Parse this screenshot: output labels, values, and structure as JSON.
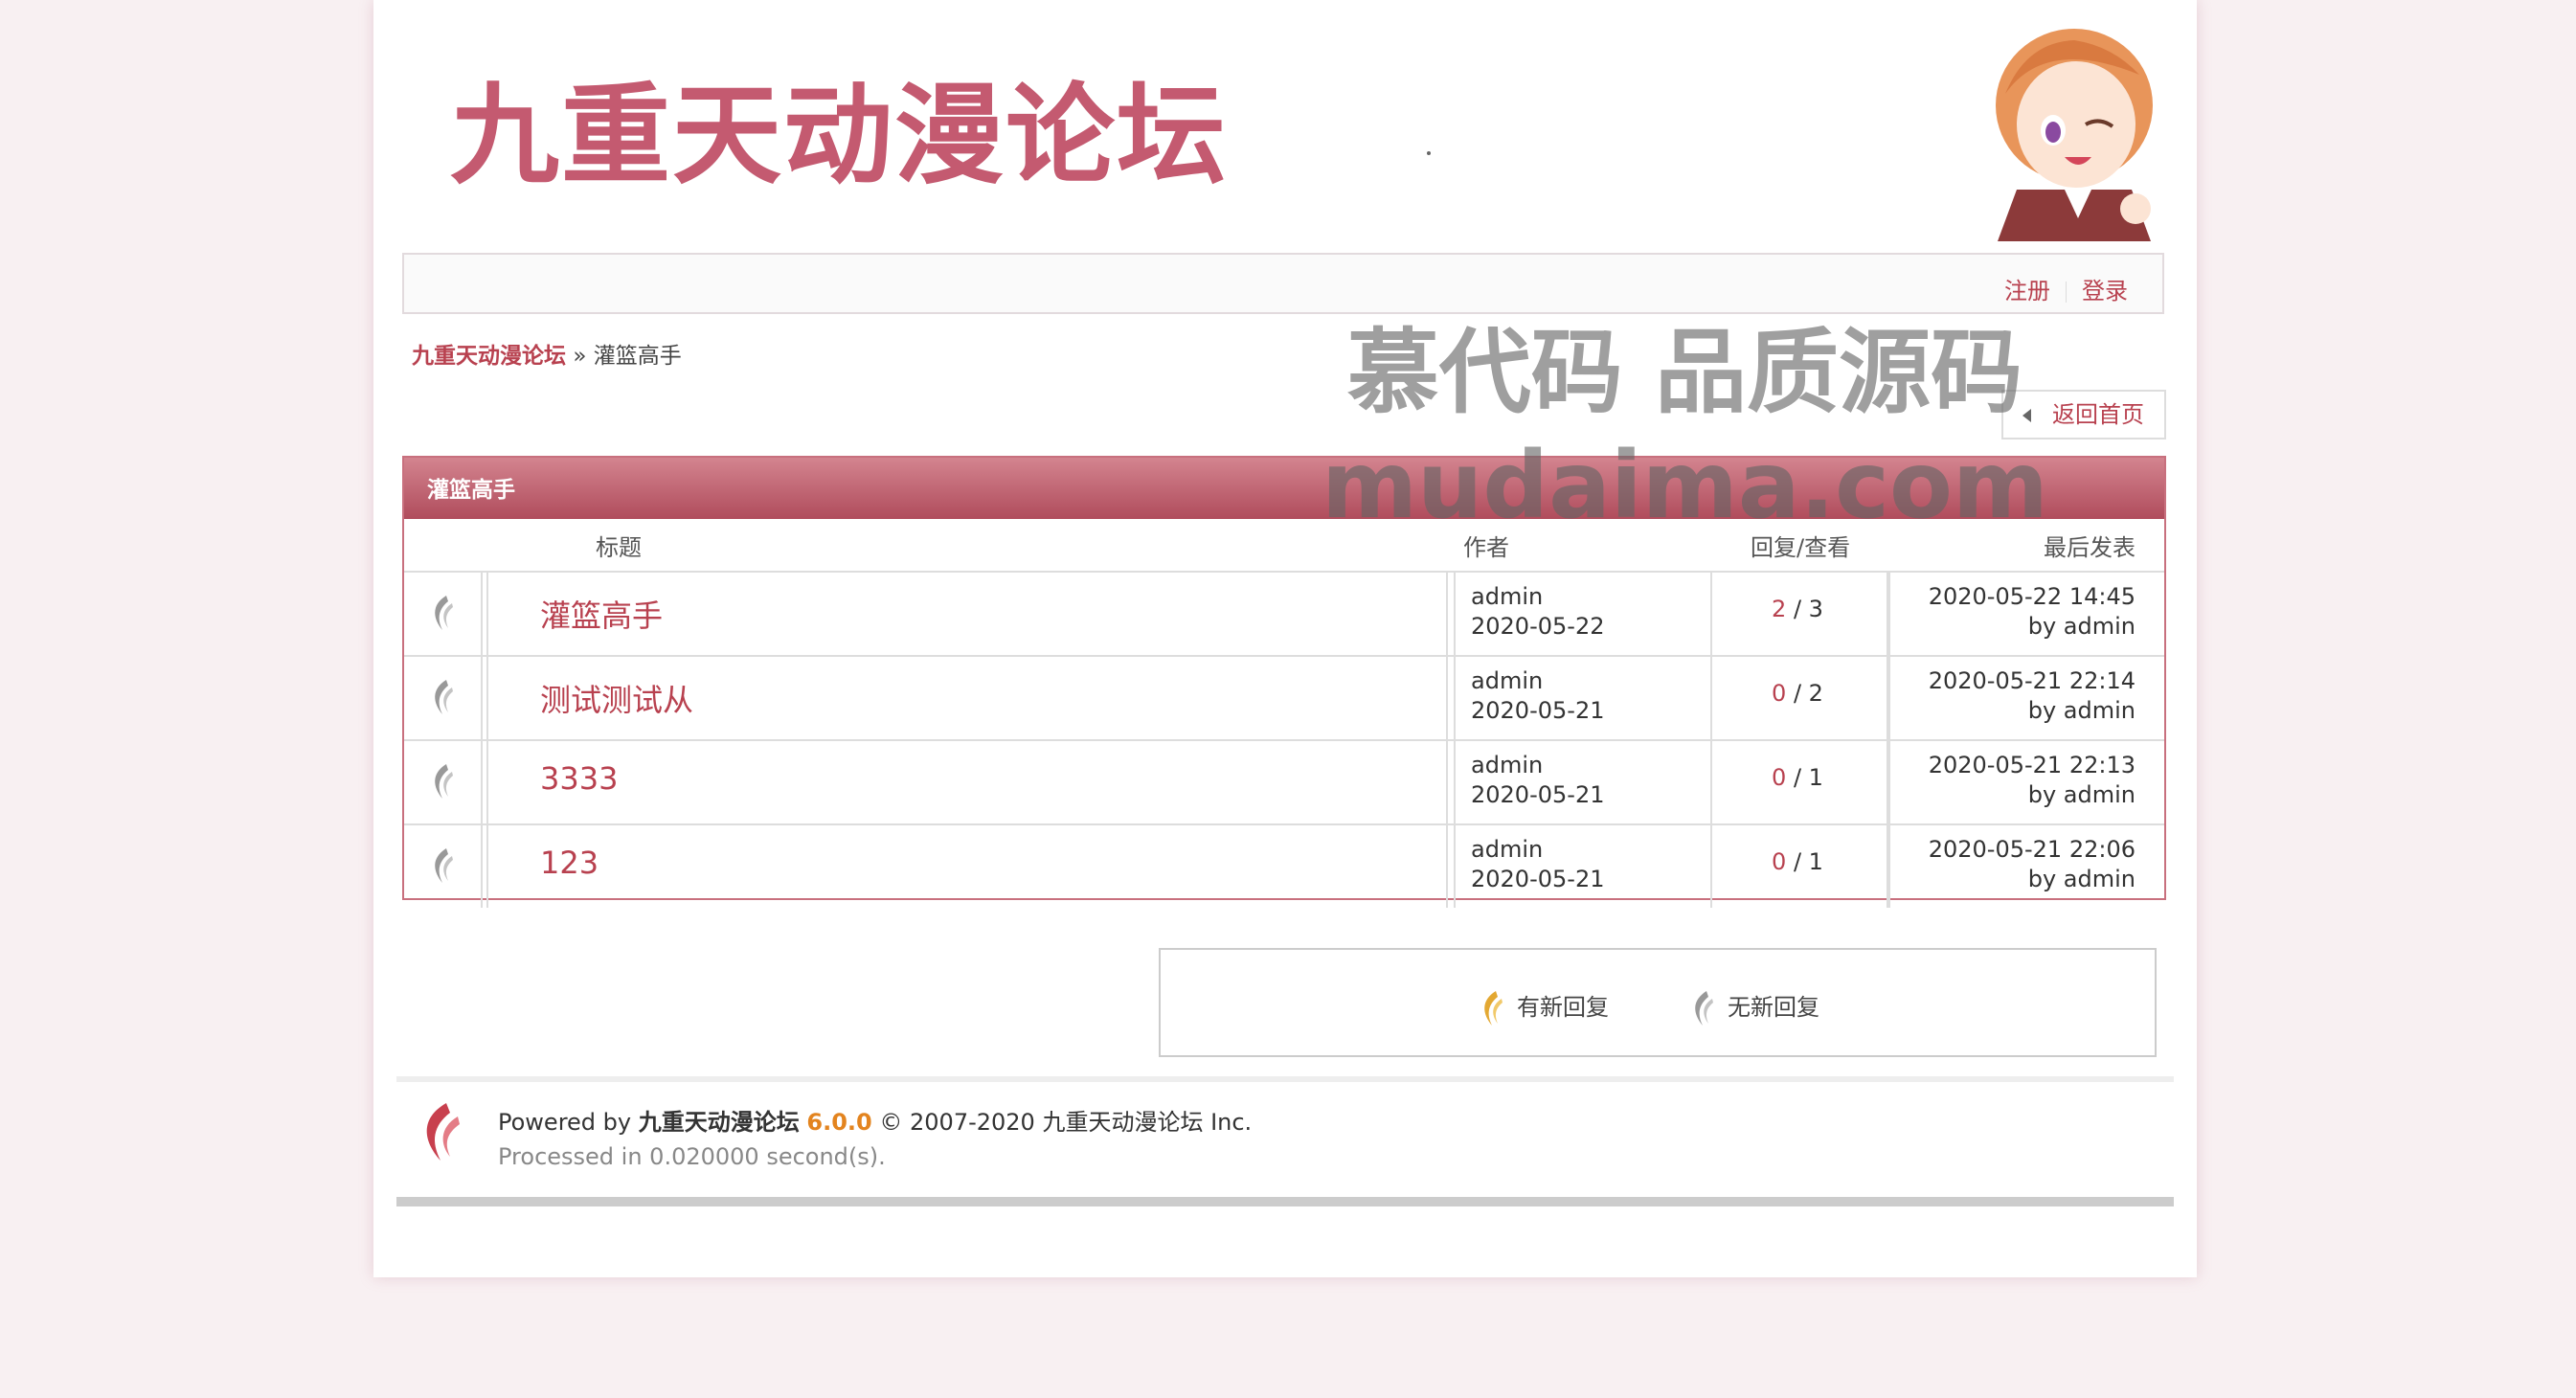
{
  "header": {
    "logo_text": "九重天动漫论坛"
  },
  "userbar": {
    "register": "注册",
    "login": "登录"
  },
  "breadcrumb": {
    "home": "九重天动漫论坛",
    "separator": "»",
    "current": "灌篮高手"
  },
  "back_button": "返回首页",
  "board": {
    "title": "灌篮高手",
    "columns": {
      "title": "标题",
      "author": "作者",
      "replies_views": "回复/查看",
      "last_post": "最后发表"
    },
    "threads": [
      {
        "title": "灌篮高手",
        "author": "admin",
        "date": "2020-05-22",
        "replies": "2",
        "views": "3",
        "last_time": "2020-05-22 14:45",
        "last_by": "by admin"
      },
      {
        "title": "测试测试从",
        "author": "admin",
        "date": "2020-05-21",
        "replies": "0",
        "views": "2",
        "last_time": "2020-05-21 22:14",
        "last_by": "by admin"
      },
      {
        "title": "3333",
        "author": "admin",
        "date": "2020-05-21",
        "replies": "0",
        "views": "1",
        "last_time": "2020-05-21 22:13",
        "last_by": "by admin"
      },
      {
        "title": "123",
        "author": "admin",
        "date": "2020-05-21",
        "replies": "0",
        "views": "1",
        "last_time": "2020-05-21 22:06",
        "last_by": "by admin"
      }
    ]
  },
  "legend": {
    "new_reply": "有新回复",
    "no_new_reply": "无新回复"
  },
  "footer": {
    "powered_by": "Powered by",
    "name": "九重天动漫论坛",
    "version": "6.0.0",
    "copyright": "© 2007-2020 九重天动漫论坛 Inc.",
    "processed": "Processed in 0.020000 second(s)."
  },
  "watermark": {
    "line1": "慕代码 品质源码",
    "line2": "mudaima.com"
  },
  "colors": {
    "accent": "#b8414f",
    "header_bar": "#c0606e",
    "version": "#e3841f",
    "page_bg": "#f8f0f2"
  },
  "icons": {
    "thread_status": "flame-gray-icon",
    "new_reply": "flame-gold-icon",
    "no_new_reply": "flame-gray-icon",
    "footer_logo": "flame-red-icon"
  }
}
